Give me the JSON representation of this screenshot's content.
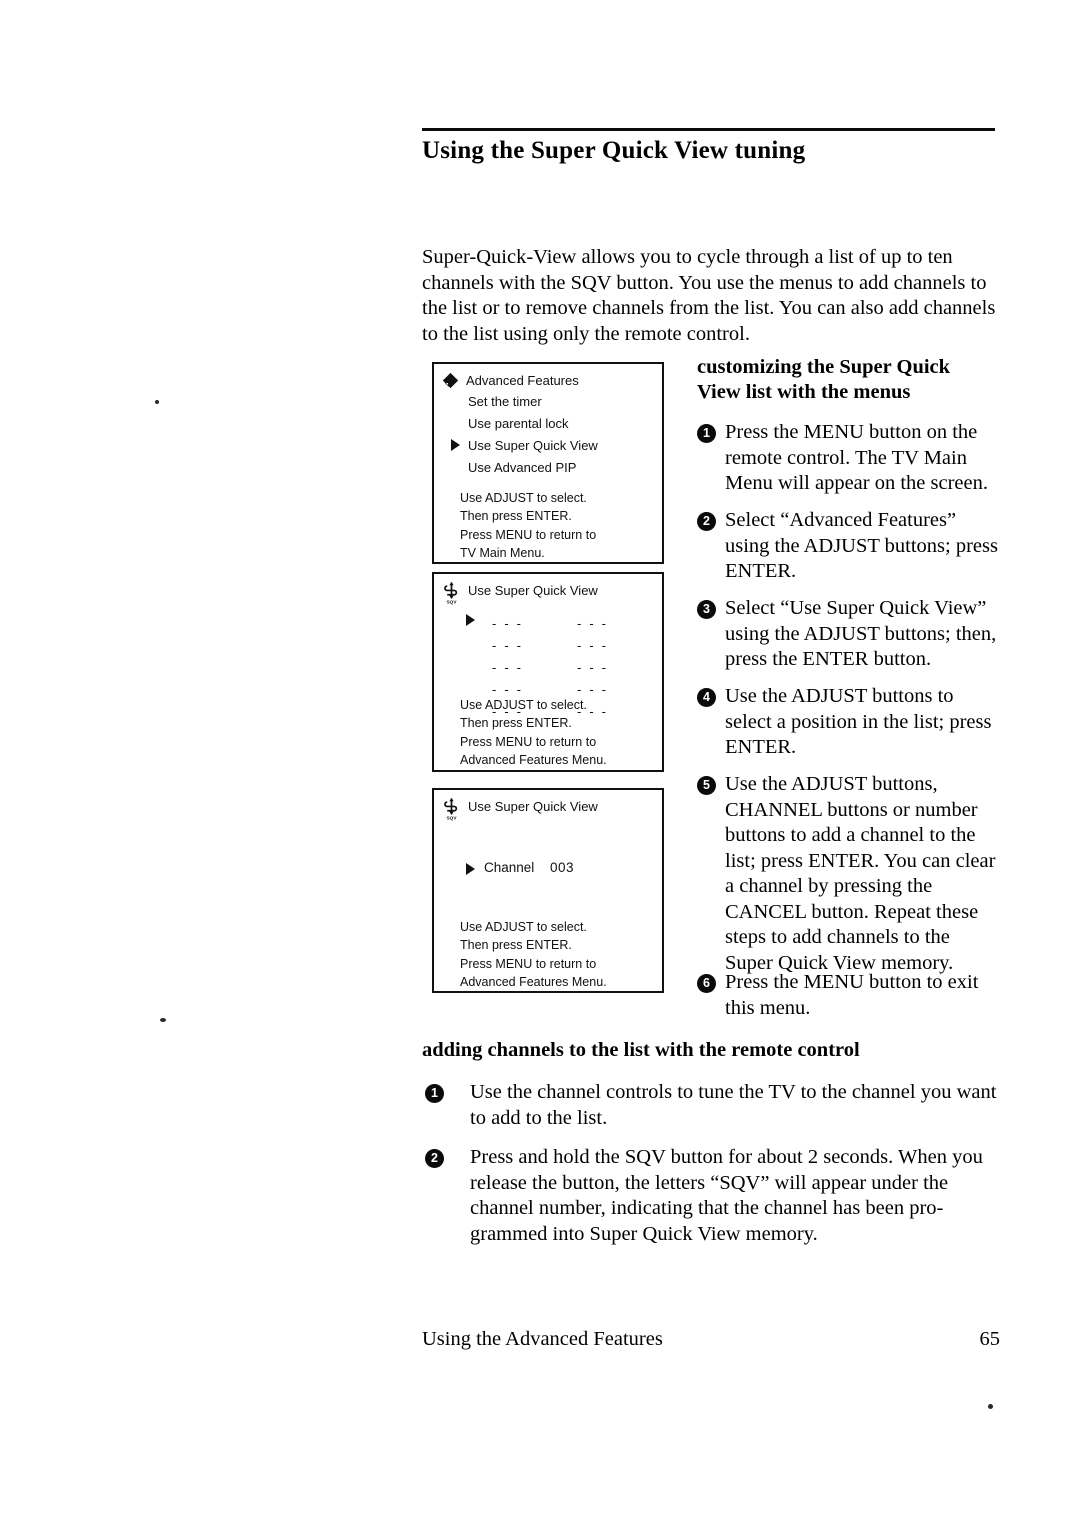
{
  "document": {
    "title": "Using the Super Quick View tuning",
    "intro": "Super-Quick-View allows you to cycle through a list of up to ten channels with the SQV button. You use the menus to add channels to the list or to remove channels from the list. You can also add channels to the list using only the remote control."
  },
  "screens": [
    {
      "icon": "diamond-icon",
      "title": "Advanced Features",
      "items": [
        {
          "label": "Set the timer",
          "selected": false
        },
        {
          "label": "Use parental lock",
          "selected": false
        },
        {
          "label": "Use Super Quick View",
          "selected": true
        },
        {
          "label": "Use Advanced PIP",
          "selected": false
        }
      ],
      "footnotes": [
        "Use ADJUST to select.",
        "Then press ENTER.",
        "Press MENU to return to",
        "TV Main Menu."
      ]
    },
    {
      "icon": "sqv-icon",
      "title": "Use Super Quick View",
      "slots": [
        [
          "- - -",
          "- - -"
        ],
        [
          "- - -",
          "- - -"
        ],
        [
          "- - -",
          "- - -"
        ],
        [
          "- - -",
          "- - -"
        ],
        [
          "- - -",
          "- - -"
        ]
      ],
      "footnotes": [
        "Use ADJUST to select.",
        "Then press ENTER.",
        "Press MENU to return to",
        "Advanced Features Menu."
      ]
    },
    {
      "icon": "sqv-icon",
      "title": "Use Super Quick View",
      "channel_label": "Channel",
      "channel_value": "003",
      "footnotes": [
        "Use ADJUST to select.",
        "Then press ENTER.",
        "Press MENU to return to",
        "Advanced Features Menu."
      ]
    }
  ],
  "right_column": {
    "heading": "customizing the Super Quick View list with the menus",
    "steps": [
      {
        "num": "1",
        "text": "Press the MENU button on the remote control. The TV Main Menu will appear on the screen."
      },
      {
        "num": "2",
        "text": "Select “Advanced Features” using the ADJUST buttons; press ENTER."
      },
      {
        "num": "3",
        "text": "Select “Use Super Quick View” using the ADJUST buttons; then, press the ENTER button."
      },
      {
        "num": "4",
        "text": "Use the ADJUST buttons to select a position in the list; press ENTER."
      },
      {
        "num": "5",
        "text": "Use the ADJUST buttons, CHANNEL buttons or number buttons to add a channel to the list; press ENTER. You can clear a channel by pressing the CANCEL button. Repeat these steps to add channels to the Super Quick View memory."
      },
      {
        "num": "6",
        "text": "Press the MENU button to exit this menu."
      }
    ]
  },
  "bottom_section": {
    "heading": "adding channels to the list with the remote control",
    "steps": [
      {
        "num": "1",
        "text": "Use the channel controls to tune the TV to the channel you want to add to the list."
      },
      {
        "num": "2",
        "text": "Press and hold the SQV button for about 2 seconds. When you release the button, the letters “SQV” will appear under the channel number, indicating that the channel has been pro-grammed into Super Quick View memory."
      }
    ]
  },
  "footer": {
    "left": "Using the Advanced Features",
    "page_number": "65"
  },
  "colors": {
    "ink": "#000000",
    "paper": "#ffffff",
    "rule": "#0b0b0b"
  }
}
